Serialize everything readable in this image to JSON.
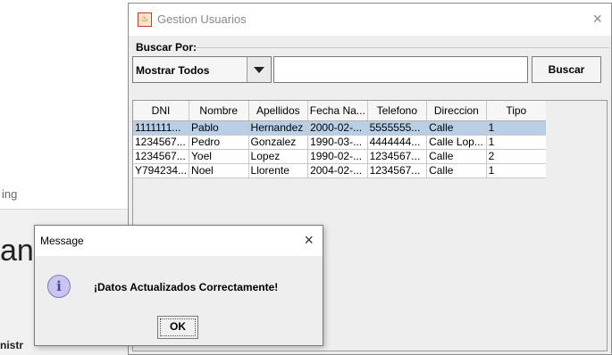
{
  "background": {
    "partial_text_top": "ing",
    "partial_text_big": "an",
    "partial_text_bottom": "nistr"
  },
  "window": {
    "title": "Gestion Usuarios",
    "close_glyph": "×",
    "icon_glyph": "♨"
  },
  "search": {
    "group_label": "Buscar Por:",
    "combo_selected": "Mostrar Todos",
    "input_value": "",
    "button_label": "Buscar"
  },
  "table": {
    "columns": [
      "DNI",
      "Nombre",
      "Apellidos",
      "Fecha Na...",
      "Telefono",
      "Direccion",
      "Tipo"
    ],
    "rows": [
      [
        "1111111...",
        "Pablo",
        "Hernandez",
        "2000-02-...",
        "5555555...",
        "Calle",
        "1"
      ],
      [
        "1234567...",
        "Pedro",
        "Gonzalez",
        "1990-03-...",
        "4444444...",
        "Calle Lop...",
        "1"
      ],
      [
        "1234567...",
        "Yoel",
        "Lopez",
        "1990-02-...",
        "1234567...",
        "Calle",
        "2"
      ],
      [
        "Y794234...",
        "Noel",
        "Llorente",
        "2004-02-...",
        "1234567...",
        "Calle",
        "1"
      ]
    ],
    "selected_row": 0
  },
  "dialog": {
    "title": "Message",
    "close_glyph": "×",
    "icon_glyph": "i",
    "message": "¡Datos Actualizados Correctamente!",
    "ok_label": "OK"
  },
  "colors": {
    "selected_row": "#b8cfe5",
    "window_bg": "#eeeeee",
    "info_icon": "#c9c6ef"
  }
}
